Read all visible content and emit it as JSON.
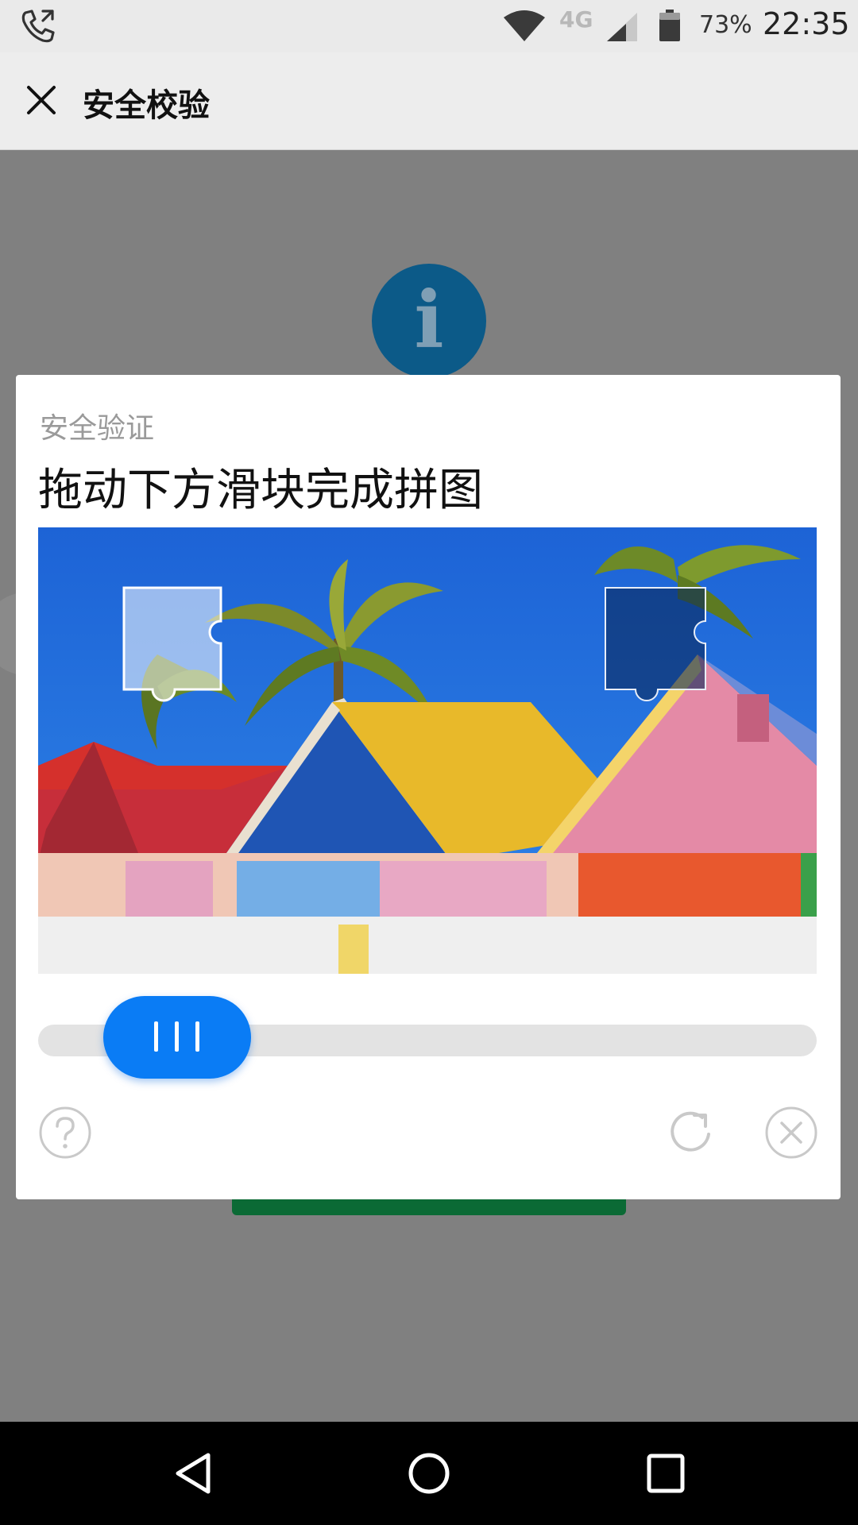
{
  "status_bar": {
    "network": "4G",
    "battery_percent": "73%",
    "time": "22:35",
    "icons": [
      "phone-call-icon",
      "wifi-icon",
      "signal-icon",
      "battery-icon"
    ]
  },
  "titlebar": {
    "title": "安全校验",
    "close_icon": "close-icon"
  },
  "background_page": {
    "info_icon": "info-icon",
    "info_glyph": "i"
  },
  "dialog": {
    "subtitle": "安全验证",
    "title": "拖动下方滑块完成拼图",
    "slider": {
      "progress": 0.09
    },
    "buttons": {
      "help_icon": "help-icon",
      "refresh_icon": "refresh-icon",
      "close_icon": "close-circle-icon"
    }
  },
  "colors": {
    "accent_blue": "#0a7cf5",
    "info_blue": "#0c5a88",
    "overlay_gray": "#808080",
    "green_button": "#0b6a35"
  },
  "navbar": {
    "icons": [
      "back-icon",
      "home-icon",
      "recents-icon"
    ]
  }
}
